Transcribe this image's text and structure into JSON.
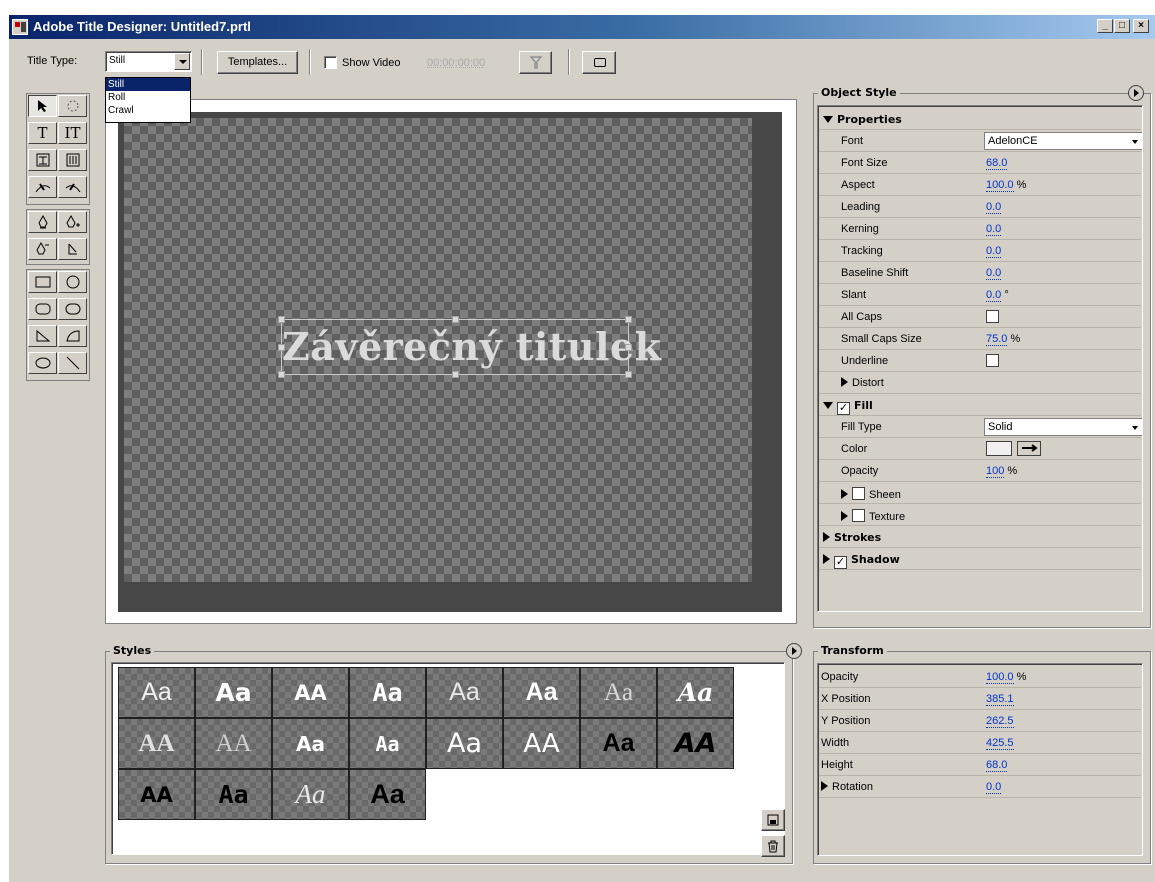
{
  "window": {
    "title": "Adobe Title Designer: Untitled7.prtl",
    "controls": [
      "_",
      "□",
      "×"
    ]
  },
  "toolbar": {
    "title_type_label": "Title Type:",
    "title_type_value": "Still",
    "title_type_options": [
      "Still",
      "Roll",
      "Crawl"
    ],
    "templates_label": "Templates...",
    "show_video_label": "Show Video",
    "show_video_checked": false,
    "timecode": "00;00;00;00"
  },
  "canvas": {
    "title_text": "Závěrečný titulek"
  },
  "object_style": {
    "panel_title": "Object Style",
    "properties_header": "Properties",
    "font_label": "Font",
    "font_value": "AdelonCE",
    "font_size_label": "Font Size",
    "font_size_value": "68.0",
    "aspect_label": "Aspect",
    "aspect_value": "100.0",
    "aspect_unit": "%",
    "leading_label": "Leading",
    "leading_value": "0.0",
    "kerning_label": "Kerning",
    "kerning_value": "0.0",
    "tracking_label": "Tracking",
    "tracking_value": "0.0",
    "baseline_label": "Baseline Shift",
    "baseline_value": "0.0",
    "slant_label": "Slant",
    "slant_value": "0.0",
    "slant_unit": "°",
    "allcaps_label": "All Caps",
    "smallcaps_label": "Small Caps Size",
    "smallcaps_value": "75.0",
    "smallcaps_unit": "%",
    "underline_label": "Underline",
    "distort_label": "Distort",
    "fill_header": "Fill",
    "fill_type_label": "Fill Type",
    "fill_type_value": "Solid",
    "color_label": "Color",
    "opacity_label": "Opacity",
    "opacity_value": "100",
    "opacity_unit": "%",
    "sheen_label": "Sheen",
    "texture_label": "Texture",
    "strokes_label": "Strokes",
    "shadow_label": "Shadow"
  },
  "transform": {
    "panel_title": "Transform",
    "opacity_label": "Opacity",
    "opacity_value": "100.0",
    "opacity_unit": "%",
    "x_label": "X Position",
    "x_value": "385.1",
    "y_label": "Y Position",
    "y_value": "262.5",
    "width_label": "Width",
    "width_value": "425.5",
    "height_label": "Height",
    "height_value": "68.0",
    "rotation_label": "Rotation",
    "rotation_value": "0.0"
  },
  "styles": {
    "panel_title": "Styles",
    "swatches": [
      "Aa",
      "Aa",
      "AA",
      "Aa",
      "Aa",
      "Aa",
      "Aa",
      "Aa",
      "AA",
      "AA",
      "Aa",
      "Aa",
      "Aa",
      "AA",
      "Aa",
      "AA",
      "AA",
      "Aa",
      "Aa",
      "Aa"
    ]
  },
  "colors": {
    "title_gradient_start": "#0a246a",
    "dialog_bg": "#d4d0c8",
    "link_value": "#0033cc"
  }
}
